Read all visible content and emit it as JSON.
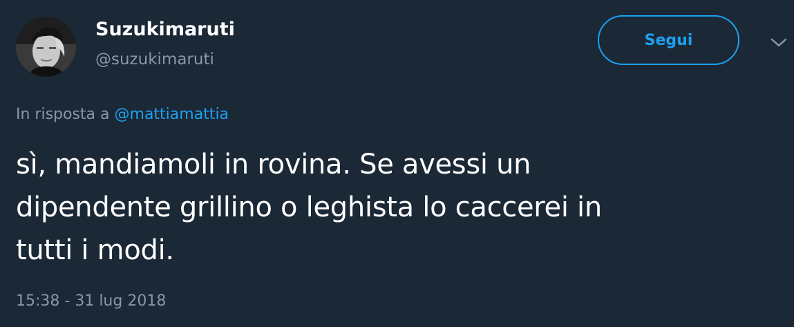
{
  "author": {
    "name": "Suzukimaruti",
    "handle": "@suzukimaruti"
  },
  "follow_button": {
    "label": "Segui"
  },
  "reply_context": {
    "prefix": "In risposta a",
    "mention": "@mattiamattia"
  },
  "tweet": {
    "lines": [
      "sì, mandiamoli in rovina. Se avessi un",
      "dipendente grillino o leghista lo caccerei in",
      "tutti i modi."
    ],
    "timestamp": "15:38 - 31 lug 2018"
  },
  "icons": {
    "more": "chevron-down-icon"
  },
  "colors": {
    "background": "#1b2836",
    "accent": "#1da1f2",
    "muted_text": "#8899a6",
    "text": "#ffffff"
  }
}
